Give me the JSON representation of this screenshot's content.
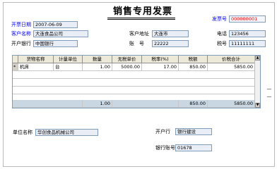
{
  "invoice": {
    "title": "销售专用发票",
    "date_label": "开票日期",
    "date_value": "2007-06-09",
    "number_label": "发票号",
    "number_value": "000000001",
    "customer_name_label": "客户名称",
    "customer_name_value": "大连食品公司",
    "customer_address_label": "客户地址",
    "customer_address_value": "大连市",
    "phone_label": "电话",
    "phone_value": "123456",
    "bank_label": "开户银行",
    "bank_value": "中国银行",
    "account_label": "账　号",
    "account_value": "22222",
    "tax_no_label": "税号",
    "tax_no_value": "11111111"
  },
  "grid": {
    "columns": [
      "货物名称",
      "计量单位",
      "数量",
      "无税单价",
      "税率(%)",
      "税额",
      "价税合计"
    ],
    "rows": [
      {
        "marker": "*",
        "name": "机床",
        "unit": "台",
        "qty": "1.00",
        "price": "5000.00",
        "rate": "17.00",
        "tax": "850.00",
        "total": "5850.00"
      }
    ],
    "totals": {
      "qty": "1.00",
      "tax": "850.00",
      "total": "5850.00"
    }
  },
  "footer": {
    "unit_name_label": "单位名称",
    "unit_name_value": "华创食品机械公司",
    "open_bank_label": "开户行",
    "open_bank_value": "银行建设",
    "bank_account_label": "银行账号",
    "bank_account_value": "01678"
  }
}
